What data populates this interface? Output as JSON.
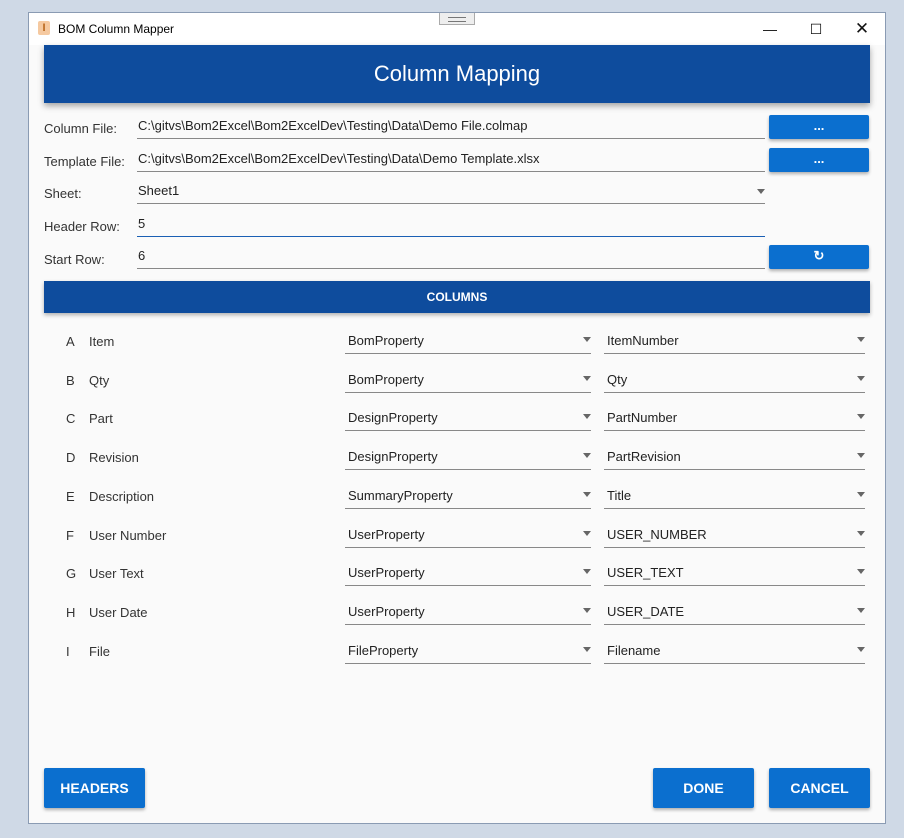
{
  "window": {
    "title": "BOM Column Mapper",
    "app_icon": "app-icon",
    "controls": [
      "minimize-icon",
      "maximize-icon",
      "close-icon"
    ]
  },
  "header": {
    "title": "Column Mapping"
  },
  "form": {
    "column_file": {
      "label": "Column File:",
      "value": "C:\\gitvs\\Bom2Excel\\Bom2ExcelDev\\Testing\\Data\\Demo File.colmap",
      "button": "..."
    },
    "template_file": {
      "label": "Template File:",
      "value": "C:\\gitvs\\Bom2Excel\\Bom2ExcelDev\\Testing\\Data\\Demo Template.xlsx",
      "button": "..."
    },
    "sheet": {
      "label": "Sheet:",
      "value": "Sheet1"
    },
    "header_row": {
      "label": "Header Row:",
      "value": "5"
    },
    "start_row": {
      "label": "Start Row:",
      "value": "6",
      "button": "↻"
    }
  },
  "columns_title": "COLUMNS",
  "columns": [
    {
      "letter": "A",
      "name": "Item",
      "type": "BomProperty",
      "property": "ItemNumber"
    },
    {
      "letter": "B",
      "name": "Qty",
      "type": "BomProperty",
      "property": "Qty"
    },
    {
      "letter": "C",
      "name": "Part",
      "type": "DesignProperty",
      "property": "PartNumber"
    },
    {
      "letter": "D",
      "name": "Revision",
      "type": "DesignProperty",
      "property": "PartRevision"
    },
    {
      "letter": "E",
      "name": "Description",
      "type": "SummaryProperty",
      "property": "Title"
    },
    {
      "letter": "F",
      "name": "User Number",
      "type": "UserProperty",
      "property": "USER_NUMBER"
    },
    {
      "letter": "G",
      "name": "User Text",
      "type": "UserProperty",
      "property": "USER_TEXT"
    },
    {
      "letter": "H",
      "name": "User Date",
      "type": "UserProperty",
      "property": "USER_DATE"
    },
    {
      "letter": "I",
      "name": "File",
      "type": "FileProperty",
      "property": "Filename"
    }
  ],
  "buttons": {
    "headers": "HEADERS",
    "done": "DONE",
    "cancel": "CANCEL"
  }
}
